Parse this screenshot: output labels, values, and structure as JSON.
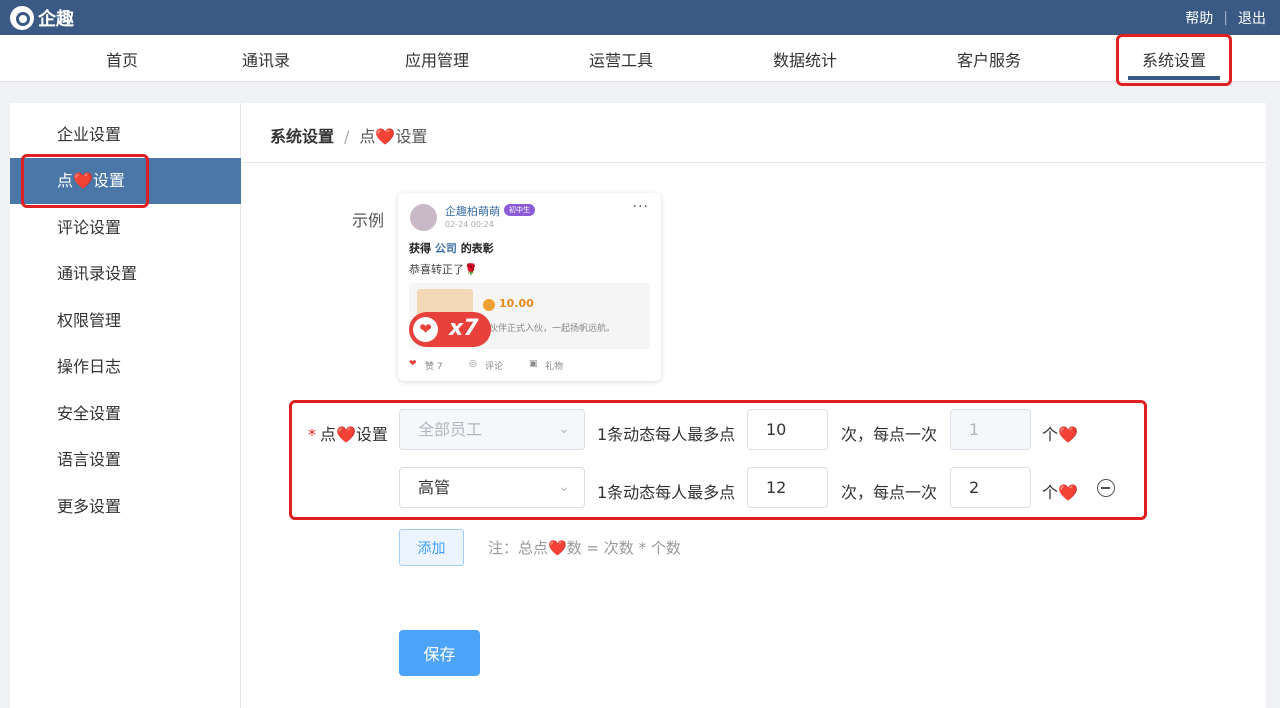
{
  "app": {
    "title": "企趣"
  },
  "toplinks": {
    "help": "帮助",
    "separator": "|",
    "logout": "退出"
  },
  "nav": {
    "items": [
      "首页",
      "通讯录",
      "应用管理",
      "运营工具",
      "数据统计",
      "客户服务",
      "系统设置"
    ],
    "active_index": 6
  },
  "sidebar": {
    "items": [
      "企业设置",
      "点❤️设置",
      "评论设置",
      "通讯录设置",
      "权限管理",
      "操作日志",
      "安全设置",
      "语言设置",
      "更多设置"
    ],
    "active_index": 1
  },
  "breadcrumb": {
    "parent": "系统设置",
    "separator": "/",
    "current": "点❤️设置"
  },
  "form": {
    "example_label": "示例",
    "like_setting_label": "点❤️设置",
    "required_mark": "*",
    "rows": [
      {
        "group": "全部员工",
        "group_disabled": true,
        "text1": "1条动态每人最多点",
        "times": "10",
        "text2": "次，每点一次",
        "per": "1",
        "per_disabled": true,
        "unit": "个❤️"
      },
      {
        "group": "高管",
        "group_disabled": false,
        "text1": "1条动态每人最多点",
        "times": "12",
        "text2": "次，每点一次",
        "per": "2",
        "per_disabled": false,
        "unit": "个❤️"
      }
    ],
    "add_label": "添加",
    "note": "注：总点❤️数 = 次数 * 个数",
    "save_label": "保存"
  },
  "example_card": {
    "name": "企趣柏萌萌",
    "badge": "初中生",
    "time": "02-24 00:24",
    "more": "···",
    "title_prefix": "获得",
    "title_company": "公司",
    "title_suffix": "的表彰",
    "message": "恭喜转正了🌹",
    "coin": "10.00",
    "desc": "伙伴正式入伙，一起扬帆远航。",
    "like_badge": "x7",
    "like_heart": "❤",
    "footer_like": "赞 7",
    "footer_comment": "评论",
    "footer_gift": "礼物"
  },
  "colors": {
    "topbar": "#3a5a85",
    "accent": "#4a77a8",
    "highlight": "#e02020",
    "primary_button": "#4da3f7"
  }
}
